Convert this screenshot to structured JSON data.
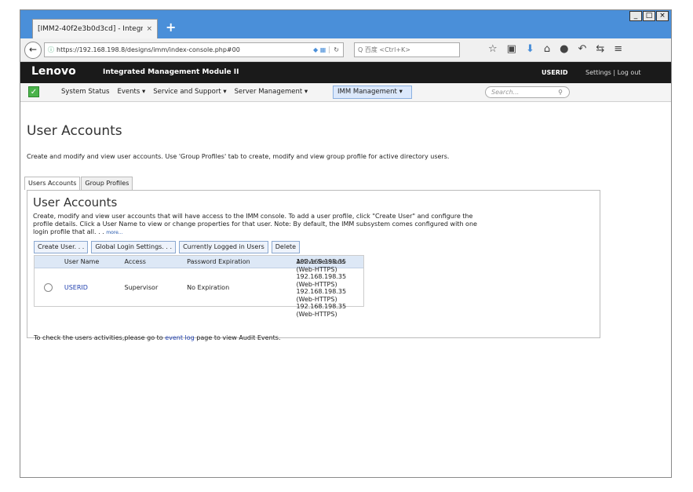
{
  "browser": {
    "tab_title": "[IMM2-40f2e3b0d3cd] - Integr...",
    "tab_close": "×",
    "new_tab": "+",
    "window_controls": [
      "_",
      "□",
      "×"
    ],
    "url": "https://192.168.198.8/designs/imm/index-console.php#00",
    "search_placeholder": "Q 百度 <Ctrl+K>"
  },
  "header": {
    "logo": "Lenovo",
    "product": "Integrated Management Module II",
    "user": "USERID",
    "links": "Settings  |  Log out"
  },
  "menu": {
    "items": [
      "System Status",
      "Events ▾",
      "Service and Support ▾",
      "Server Management ▾"
    ],
    "active": "IMM Management ▾",
    "search_placeholder": "Search..."
  },
  "page": {
    "title": "User Accounts",
    "description": "Create and modify and view user accounts. Use 'Group Profiles' tab to create, modify and view group profile for active directory users.",
    "tabs": [
      "Users Accounts",
      "Group Profiles"
    ]
  },
  "section": {
    "title": "User Accounts",
    "description": "Create, modify and view user accounts that will have access to the IMM console. To add a user profile, click \"Create User\" and configure the profile details. Click a User Name to view or change properties for that user. Note: By default, the IMM subsystem comes configured with one login profile that all. . .",
    "more": "more...",
    "buttons": [
      "Create User. . .",
      "Global Login Settings. . .",
      "Currently Logged in Users",
      "Delete"
    ]
  },
  "table": {
    "columns": [
      "User Name",
      "Access",
      "Password Expiration",
      "Active Sessions"
    ],
    "rows": [
      {
        "user": "USERID",
        "access": "Supervisor",
        "expiration": "No Expiration",
        "sessions": [
          "192.168.198.35 (Web-HTTPS)",
          "192.168.198.35 (Web-HTTPS)",
          "192.168.198.35 (Web-HTTPS)",
          "192.168.198.35 (Web-HTTPS)"
        ]
      }
    ]
  },
  "footer": {
    "pre": "To check the users activities,please go to ",
    "link": "event log",
    "post": " page to view Audit Events."
  },
  "colors": {
    "titlebar": "#4a8fd9",
    "header": "#1a1a1a",
    "link": "#1f3fae",
    "status_ok": "#4bb34b"
  }
}
